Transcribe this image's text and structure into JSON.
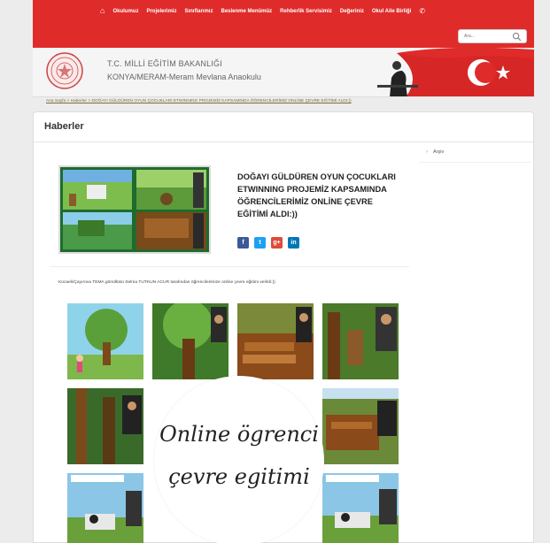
{
  "nav": {
    "items": [
      "Okulumuz",
      "Projelerimiz",
      "Sınıflarımız",
      "Beslenme Menümüz",
      "Rehberlik Servisimiz",
      "Değeriniz",
      "Okul Aile Birliği"
    ],
    "home_icon": "home-icon",
    "phone_icon": "phone-icon"
  },
  "search": {
    "placeholder": "Ara..."
  },
  "header": {
    "ministry": "T.C. MİLLİ EĞİTİM BAKANLIĞI",
    "school": "KONYA/MERAM-Meram Mevlana Anaokulu"
  },
  "breadcrumb": "Ana Sayfa > Haberler > DOĞAYI GÜLDÜREN OYUN ÇOCUKLARI ETWINNING PROJEMİZ KAPSAMINDA ÖĞRENCİLERİMİZ ONLİNE ÇEVRE EĞİTİMİ ALDI:))",
  "page": {
    "title": "Haberler"
  },
  "sidebar": {
    "archive": "Arşiv"
  },
  "article": {
    "title": "DOĞAYI GÜLDÜREN OYUN ÇOCUKLARI ETWINNING PROJEMİZ KAPSAMINDA ÖĞRENCİLERİMİZ ONLİNE ÇEVRE EĞİTİMİ ALDI:))",
    "lead": "Kocaeli/Çayırova TEMA gönüllüsü Selma TUTKUN ACUR tarafından öğrencilerimize online çevre eğitimi verildi:))",
    "share": {
      "facebook": "f",
      "twitter": "t",
      "googleplus": "g+",
      "linkedin": "in"
    },
    "overlay": {
      "line1": "Online ögrenci",
      "line2": "çevre egitimi"
    }
  },
  "colors": {
    "nav_red": "#e02b2b",
    "facebook": "#3b5998",
    "twitter": "#1da1f2",
    "googleplus": "#dd4b39",
    "linkedin": "#0077b5"
  }
}
